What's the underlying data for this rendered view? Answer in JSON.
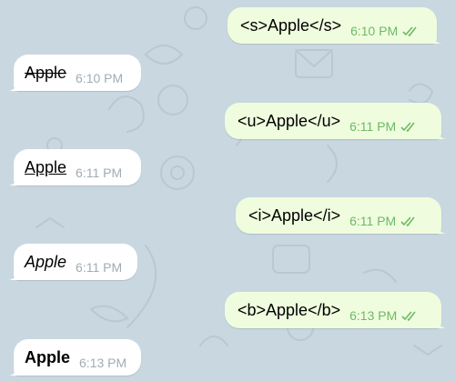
{
  "chat": {
    "messages": [
      {
        "direction": "out",
        "text": "<s>Apple</s>",
        "time": "6:10 PM",
        "status": "read-double-check-icon"
      },
      {
        "direction": "in",
        "text": "Apple",
        "format": "strikethrough",
        "time": "6:10 PM"
      },
      {
        "direction": "out",
        "text": "<u>Apple</u>",
        "time": "6:11 PM",
        "status": "read-double-check-icon"
      },
      {
        "direction": "in",
        "text": "Apple",
        "format": "underline",
        "time": "6:11 PM"
      },
      {
        "direction": "out",
        "text": "<i>Apple</i>",
        "time": "6:11 PM",
        "status": "read-double-check-icon"
      },
      {
        "direction": "in",
        "text": "Apple",
        "format": "italic",
        "time": "6:11 PM"
      },
      {
        "direction": "out",
        "text": "<b>Apple</b>",
        "time": "6:13 PM",
        "status": "read-double-check-icon"
      },
      {
        "direction": "in",
        "text": "Apple",
        "format": "bold",
        "time": "6:13 PM"
      }
    ]
  },
  "colors": {
    "background": "#c9d7e1",
    "outgoing_bubble": "#effdde",
    "incoming_bubble": "#ffffff",
    "outgoing_time": "#6eb965",
    "incoming_time": "#a0acb6"
  }
}
